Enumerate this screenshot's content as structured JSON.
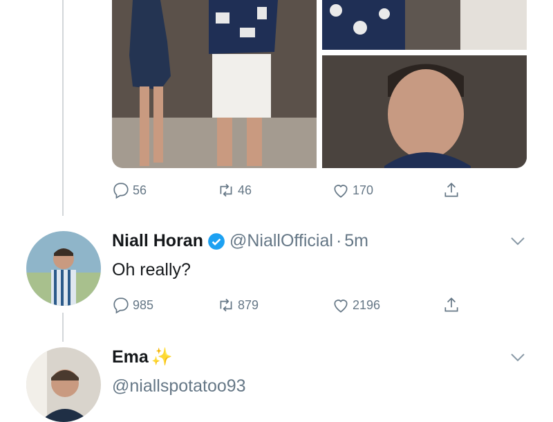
{
  "tweet_1": {
    "replies": "56",
    "retweets": "46",
    "likes": "170"
  },
  "tweet_2": {
    "name": "Niall Horan",
    "handle": "@NiallOfficial",
    "separator": "·",
    "time": "5m",
    "text": "Oh really?",
    "replies": "985",
    "retweets": "879",
    "likes": "2196"
  },
  "tweet_3": {
    "name": "Ema",
    "handle": "@niallspotatoo93"
  },
  "icons": {
    "reply": "reply-icon",
    "retweet": "retweet-icon",
    "like": "heart-icon",
    "share": "share-icon",
    "verified": "verified-badge-icon",
    "more": "chevron-down-icon",
    "sparkles": "sparkles-icon"
  },
  "colors": {
    "twitter_blue": "#1da1f2",
    "secondary_text": "#657786",
    "primary_text": "#14171a"
  }
}
